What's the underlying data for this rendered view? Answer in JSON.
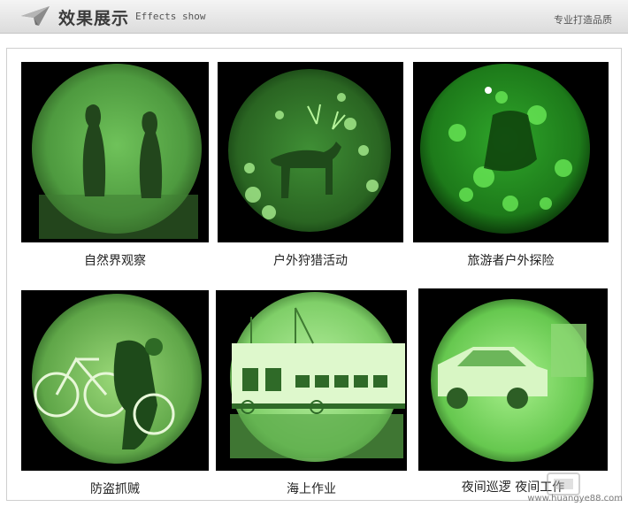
{
  "header": {
    "title": "效果展示",
    "subtitle": "Effects show",
    "slogan": "专业打造品质"
  },
  "panels": [
    {
      "caption": "自然界观察"
    },
    {
      "caption": "户外狩猎活动"
    },
    {
      "caption": "旅游者户外探险"
    },
    {
      "caption": "防盗抓贼"
    },
    {
      "caption": "海上作业"
    },
    {
      "caption": "夜间巡逻 夜间工作"
    }
  ],
  "watermark": {
    "site": "www.huangye88.com"
  },
  "colors": {
    "night_vision_green": "#5fd650",
    "night_vision_dark": "#1c4a18",
    "panel_background": "#000000"
  }
}
